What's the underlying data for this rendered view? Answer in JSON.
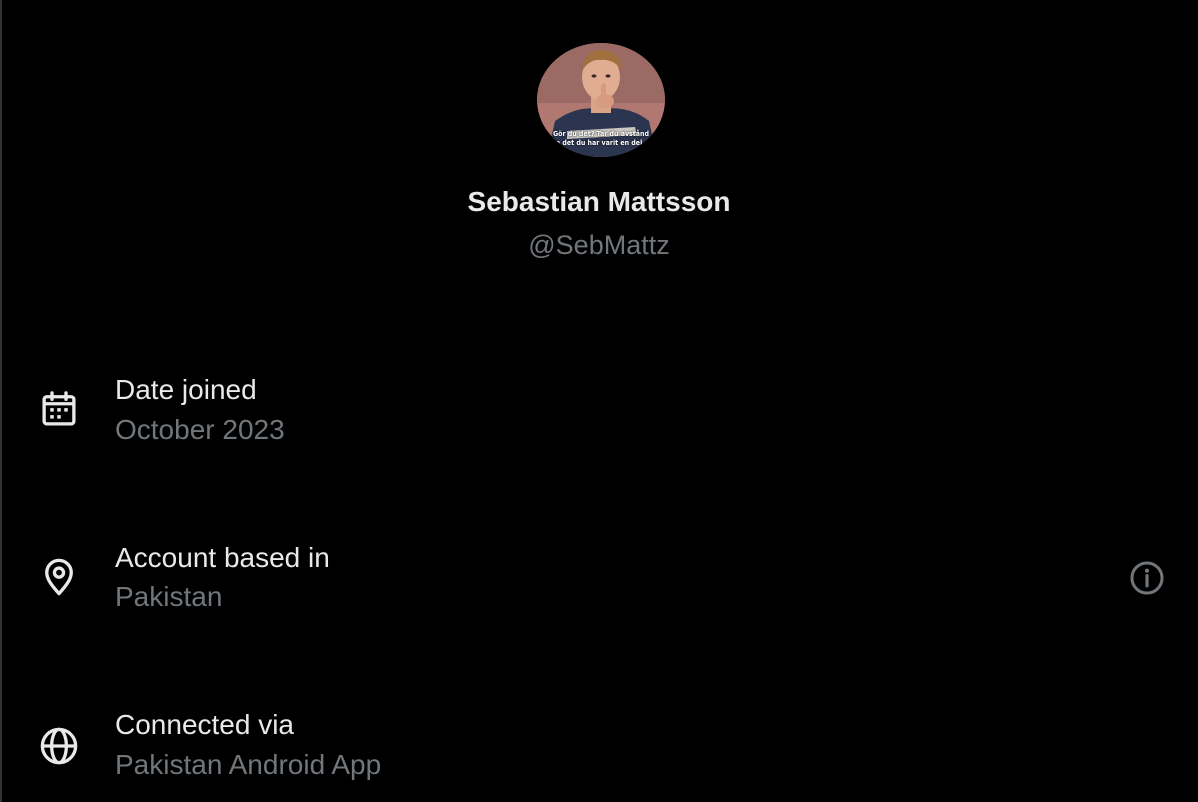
{
  "profile": {
    "display_name": "Sebastian Mattsson",
    "handle": "@SebMattz",
    "avatar_caption_line1": "Gör du det? Tar du avstånd",
    "avatar_caption_line2": "från det du har varit en del av?"
  },
  "about": {
    "items": [
      {
        "icon": "calendar-icon",
        "label": "Date joined",
        "value": "October 2023"
      },
      {
        "icon": "location-pin-icon",
        "label": "Account based in",
        "value": "Pakistan"
      },
      {
        "icon": "globe-icon",
        "label": "Connected via",
        "value": "Pakistan Android App"
      }
    ],
    "info_icon": "info-icon"
  },
  "colors": {
    "background": "#000000",
    "primary_text": "#e7e9ea",
    "secondary_text": "#71767b"
  }
}
